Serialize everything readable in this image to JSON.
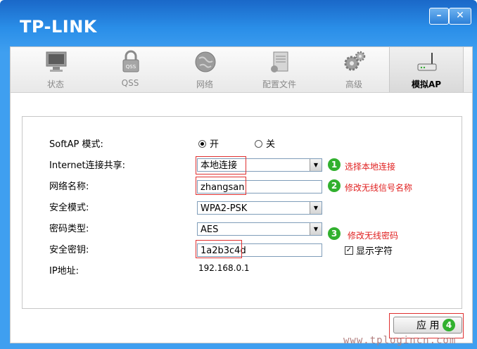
{
  "app": {
    "brand": "TP-LINK",
    "min_label": "–",
    "close_label": "✕"
  },
  "tabs": [
    {
      "label": "状态",
      "icon": "monitor-icon"
    },
    {
      "label": "QSS",
      "icon": "lock-icon"
    },
    {
      "label": "网络",
      "icon": "globe-icon"
    },
    {
      "label": "配置文件",
      "icon": "document-icon"
    },
    {
      "label": "高级",
      "icon": "gears-icon"
    },
    {
      "label": "模拟AP",
      "icon": "router-icon",
      "active": true
    }
  ],
  "form": {
    "softap": {
      "label": "SoftAP 模式:",
      "on": "开",
      "off": "关",
      "selected": "开"
    },
    "sharing": {
      "label": "Internet连接共享:",
      "value": "本地连接"
    },
    "ssid": {
      "label": "网络名称:",
      "value": "zhangsan"
    },
    "security": {
      "label": "安全模式:",
      "value": "WPA2-PSK"
    },
    "cipher": {
      "label": "密码类型:",
      "value": "AES"
    },
    "key": {
      "label": "安全密钥:",
      "value": "1a2b3c4d"
    },
    "show_chars": {
      "label": "显示字符",
      "checked": true
    },
    "ip": {
      "label": "IP地址:",
      "value": "192.168.0.1"
    }
  },
  "annotations": [
    {
      "num": "1",
      "text": "选择本地连接"
    },
    {
      "num": "2",
      "text": "修改无线信号名称"
    },
    {
      "num": "3",
      "text": "修改无线密码"
    },
    {
      "num": "4"
    }
  ],
  "apply_label": "应 用",
  "watermark": "www.tplogincn.com",
  "colors": {
    "accent": "#2a8ee8",
    "annotation": "#e02020",
    "badge": "#31b02e"
  }
}
